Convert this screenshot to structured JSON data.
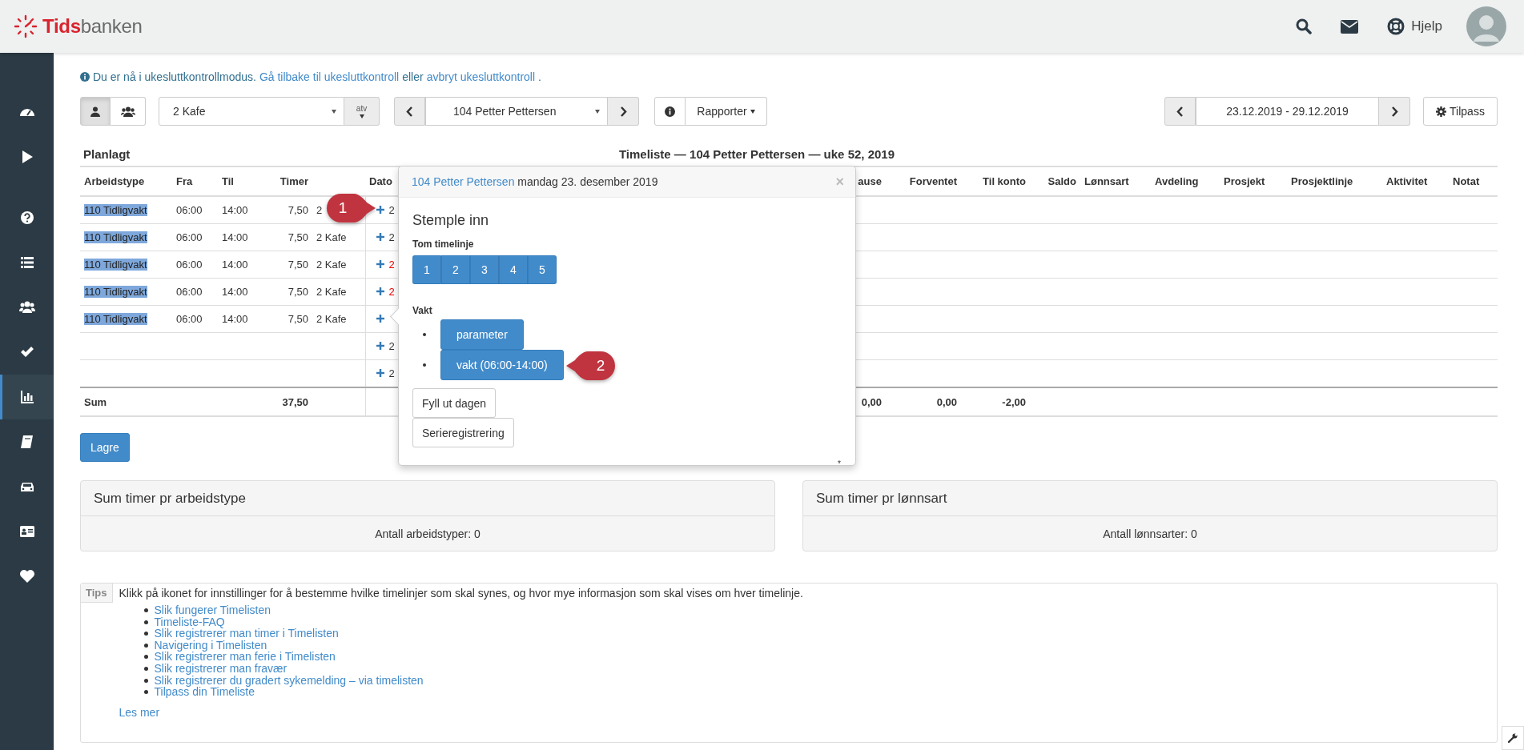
{
  "header": {
    "brand_first": "Tids",
    "brand_second": "banken",
    "help": "Hjelp"
  },
  "sidebar": {
    "items": [
      {
        "selected": false
      },
      {
        "selected": false
      },
      {
        "selected": false
      },
      {
        "selected": false
      },
      {
        "selected": false
      },
      {
        "selected": false
      },
      {
        "selected": true
      },
      {
        "selected": false
      },
      {
        "selected": false
      },
      {
        "selected": false
      },
      {
        "selected": false
      }
    ]
  },
  "notice": {
    "text": "Du er nå i ukesluttkontrollmodus.",
    "link_back": "Gå tilbake til ukesluttkontroll",
    "middle": "eller",
    "link_cancel": "avbryt ukesluttkontroll",
    "end": "."
  },
  "toolbar": {
    "view_toggle": [
      {
        "selected": true
      },
      {
        "selected": false
      }
    ],
    "department_select": "2 Kafe",
    "atv_button": "atv",
    "employee_select": "104 Petter Pettersen",
    "reports_button": "Rapporter",
    "period": "23.12.2019 - 29.12.2019",
    "customize_button": "Tilpass"
  },
  "timesheet": {
    "planned_title": "Planlagt",
    "title": "Timeliste — 104 Petter Pettersen — uke 52, 2019",
    "columns_left": [
      "Arbeidstype",
      "Fra",
      "Til",
      "Timer"
    ],
    "column_date": "Dato",
    "columns_right": [
      "ause",
      "Forventet",
      "Til konto",
      "Saldo",
      "Lønnsart",
      "Avdeling",
      "Prosjekt",
      "Prosjektlinje",
      "Aktivitet",
      "Notat"
    ],
    "rows": [
      {
        "work_type": "110 Tidligvakt",
        "from": "06:00",
        "to": "14:00",
        "hours": "7,50",
        "department": "2",
        "date": "2",
        "color": "#333333"
      },
      {
        "work_type": "110 Tidligvakt",
        "from": "06:00",
        "to": "14:00",
        "hours": "7,50",
        "department": "2 Kafe",
        "date": "2",
        "color": "#333333"
      },
      {
        "work_type": "110 Tidligvakt",
        "from": "06:00",
        "to": "14:00",
        "hours": "7,50",
        "department": "2 Kafe",
        "date": "2",
        "color": "#ee0000"
      },
      {
        "work_type": "110 Tidligvakt",
        "from": "06:00",
        "to": "14:00",
        "hours": "7,50",
        "department": "2 Kafe",
        "date": "2",
        "color": "#ee0000"
      },
      {
        "work_type": "110 Tidligvakt",
        "from": "06:00",
        "to": "14:00",
        "hours": "7,50",
        "department": "2 Kafe"
      },
      {
        "date": "2",
        "color": "#333333"
      },
      {
        "date": "2",
        "color": "#333333"
      }
    ],
    "sum": {
      "label": "Sum",
      "hours": "37,50",
      "pause": "0,00",
      "expected": "0,00",
      "to_account": "-2,00"
    },
    "save_button": "Lagre"
  },
  "popover": {
    "employee_link": "104 Petter Pettersen",
    "date": "mandag 23. desember 2019",
    "close": "×",
    "heading": "Stemple inn",
    "empty_line_label": "Tom timelinje",
    "empty_line_buttons": [
      "1",
      "2",
      "3",
      "4",
      "5"
    ],
    "shift_label": "Vakt",
    "shift_buttons": [
      "parameter",
      "vakt (06:00-14:00)"
    ],
    "fill_day_button": "Fyll ut dagen",
    "series_button": "Serieregistrering",
    "footnote": "*"
  },
  "callouts": [
    {
      "label": "1"
    },
    {
      "label": "2"
    }
  ],
  "panels": [
    {
      "title": "Sum timer pr arbeidstype",
      "body": "Antall arbeidstyper: 0"
    },
    {
      "title": "Sum timer pr lønnsart",
      "body": "Antall lønnsarter: 0"
    }
  ],
  "tips": {
    "tag": "Tips",
    "text": "Klikk på ikonet for innstillinger for å bestemme hvilke timelinjer som skal synes, og hvor mye informasjon som skal vises om hver timelinje.",
    "links": [
      "Slik fungerer Timelisten",
      "Timeliste-FAQ",
      "Slik registrerer man timer i Timelisten",
      "Navigering i Timelisten",
      "Slik registrerer man ferie i Timelisten",
      "Slik registrerer man fravær",
      "Slik registrerer du gradert sykemelding – via timelisten",
      "Tilpass din Timeliste"
    ],
    "more": "Les mer"
  }
}
